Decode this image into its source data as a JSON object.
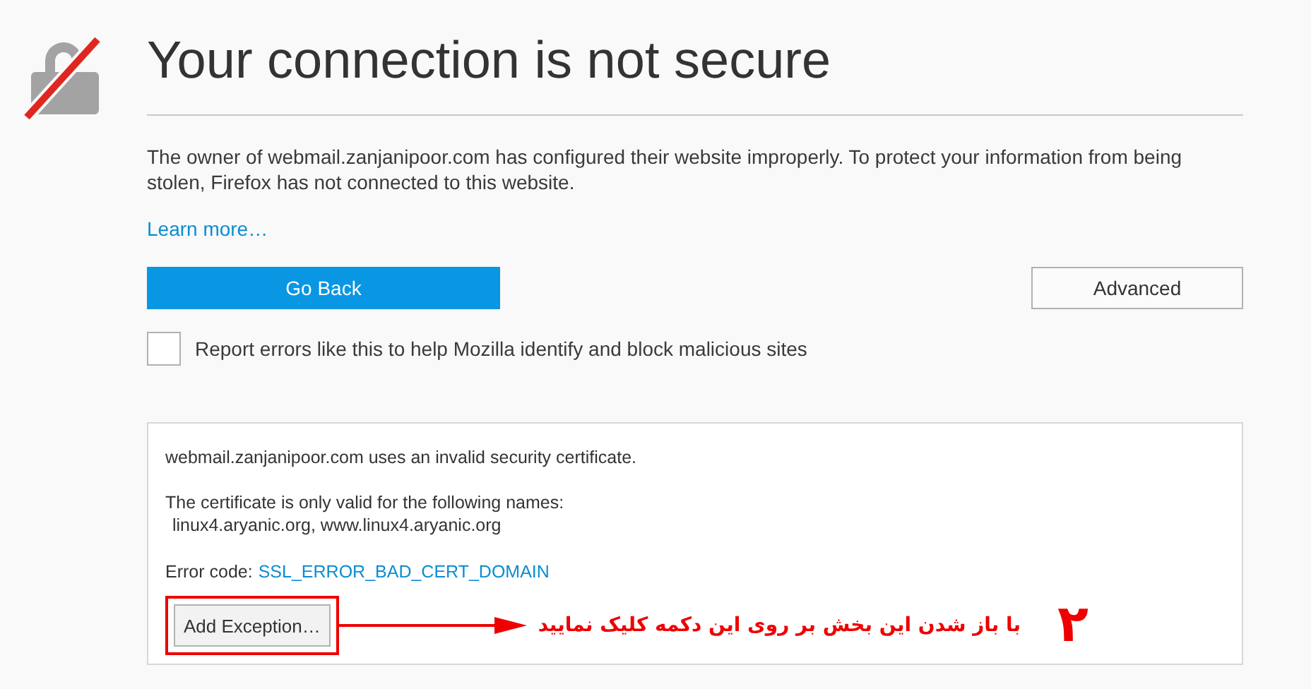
{
  "title": "Your connection is not secure",
  "description": "The owner of webmail.zanjanipoor.com has configured their website improperly. To protect your information from being stolen, Firefox has not connected to this website.",
  "learn_more": "Learn more…",
  "buttons": {
    "go_back": "Go Back",
    "advanced": "Advanced"
  },
  "report_checkbox": {
    "label": "Report errors like this to help Mozilla identify and block malicious sites",
    "checked": false
  },
  "advanced_panel": {
    "message": "webmail.zanjanipoor.com uses an invalid security certificate.",
    "valid_names_intro": "The certificate is only valid for the following names:",
    "valid_names": "linux4.aryanic.org, www.linux4.aryanic.org",
    "error_label": "Error code:",
    "error_code": "SSL_ERROR_BAD_CERT_DOMAIN",
    "add_exception": "Add Exception…"
  },
  "annotation": {
    "text": "با باز شدن این بخش بر روی این دکمه کلیک نمایید",
    "step": "٢"
  }
}
